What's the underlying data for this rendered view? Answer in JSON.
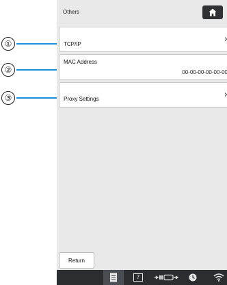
{
  "callouts": [
    "①",
    "②",
    "③"
  ],
  "header": {
    "title": "Others"
  },
  "rows": [
    {
      "label": "TCP/IP",
      "chevron": "›"
    },
    {
      "label": "MAC Address",
      "value": "00-00-00-00-00-00"
    },
    {
      "label": "Proxy Settings",
      "chevron": "›"
    }
  ],
  "footer": {
    "return_label": "Return"
  },
  "statusbar": {
    "icons": [
      "document-icon",
      "help-icon",
      "connection-icon",
      "clock-icon",
      "wifi-icon"
    ],
    "help_glyph": "?"
  },
  "colors": {
    "screen_bg": "#e9e9e9",
    "callout_line": "#1d8fd6",
    "statusbar_bg": "#2b2d30"
  }
}
